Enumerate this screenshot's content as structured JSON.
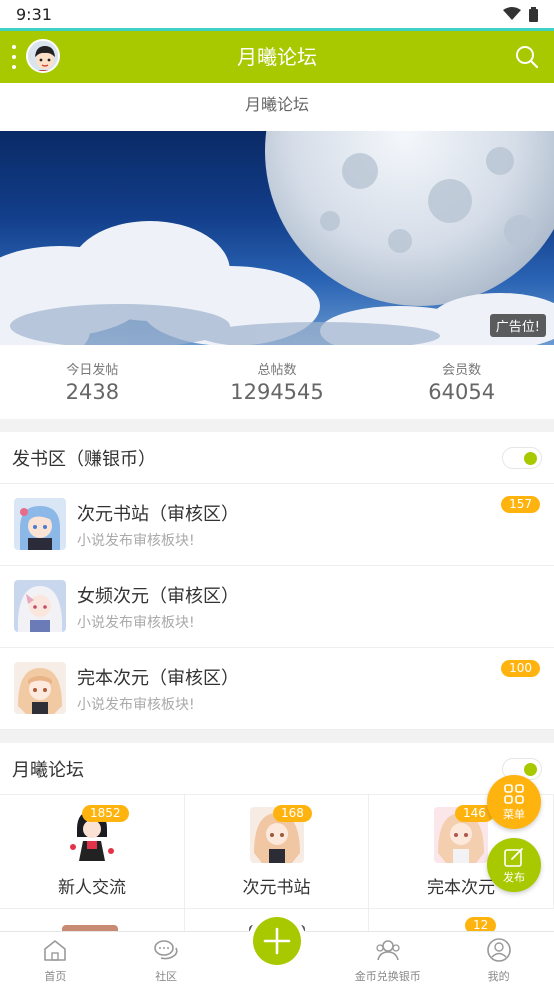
{
  "status_bar": {
    "time": "9:31"
  },
  "header": {
    "title": "月曦论坛"
  },
  "subtitle": "月曦论坛",
  "banner": {
    "ad_label": "广告位!"
  },
  "stats": [
    {
      "label": "今日发帖",
      "value": "2438"
    },
    {
      "label": "总帖数",
      "value": "1294545"
    },
    {
      "label": "会员数",
      "value": "64054"
    }
  ],
  "section_books": {
    "title": "发书区（赚银币）",
    "items": [
      {
        "title": "次元书站（审核区）",
        "desc": "小说发布审核板块!",
        "badge": "157"
      },
      {
        "title": "女频次元（审核区）",
        "desc": "小说发布审核板块!",
        "badge": ""
      },
      {
        "title": "完本次元（审核区）",
        "desc": "小说发布审核板块!",
        "badge": "100"
      }
    ]
  },
  "section_forum": {
    "title": "月曦论坛",
    "cells": [
      {
        "name": "新人交流",
        "badge": "1852"
      },
      {
        "name": "次元书站",
        "badge": "168"
      },
      {
        "name": "完本次元",
        "badge": "146"
      }
    ],
    "next_row_badge": "12"
  },
  "fabs": {
    "menu_label": "菜单",
    "post_label": "发布"
  },
  "bottom_nav": [
    {
      "label": "首页",
      "icon": "home-icon"
    },
    {
      "label": "社区",
      "icon": "chat-icon"
    },
    {
      "label": "",
      "icon": "plus-icon"
    },
    {
      "label": "金币兑换银币",
      "icon": "exchange-icon"
    },
    {
      "label": "我的",
      "icon": "user-icon"
    }
  ],
  "colors": {
    "brand": "#a8c800",
    "badge": "#ffb30f",
    "accent_line": "#3fd0c8"
  }
}
